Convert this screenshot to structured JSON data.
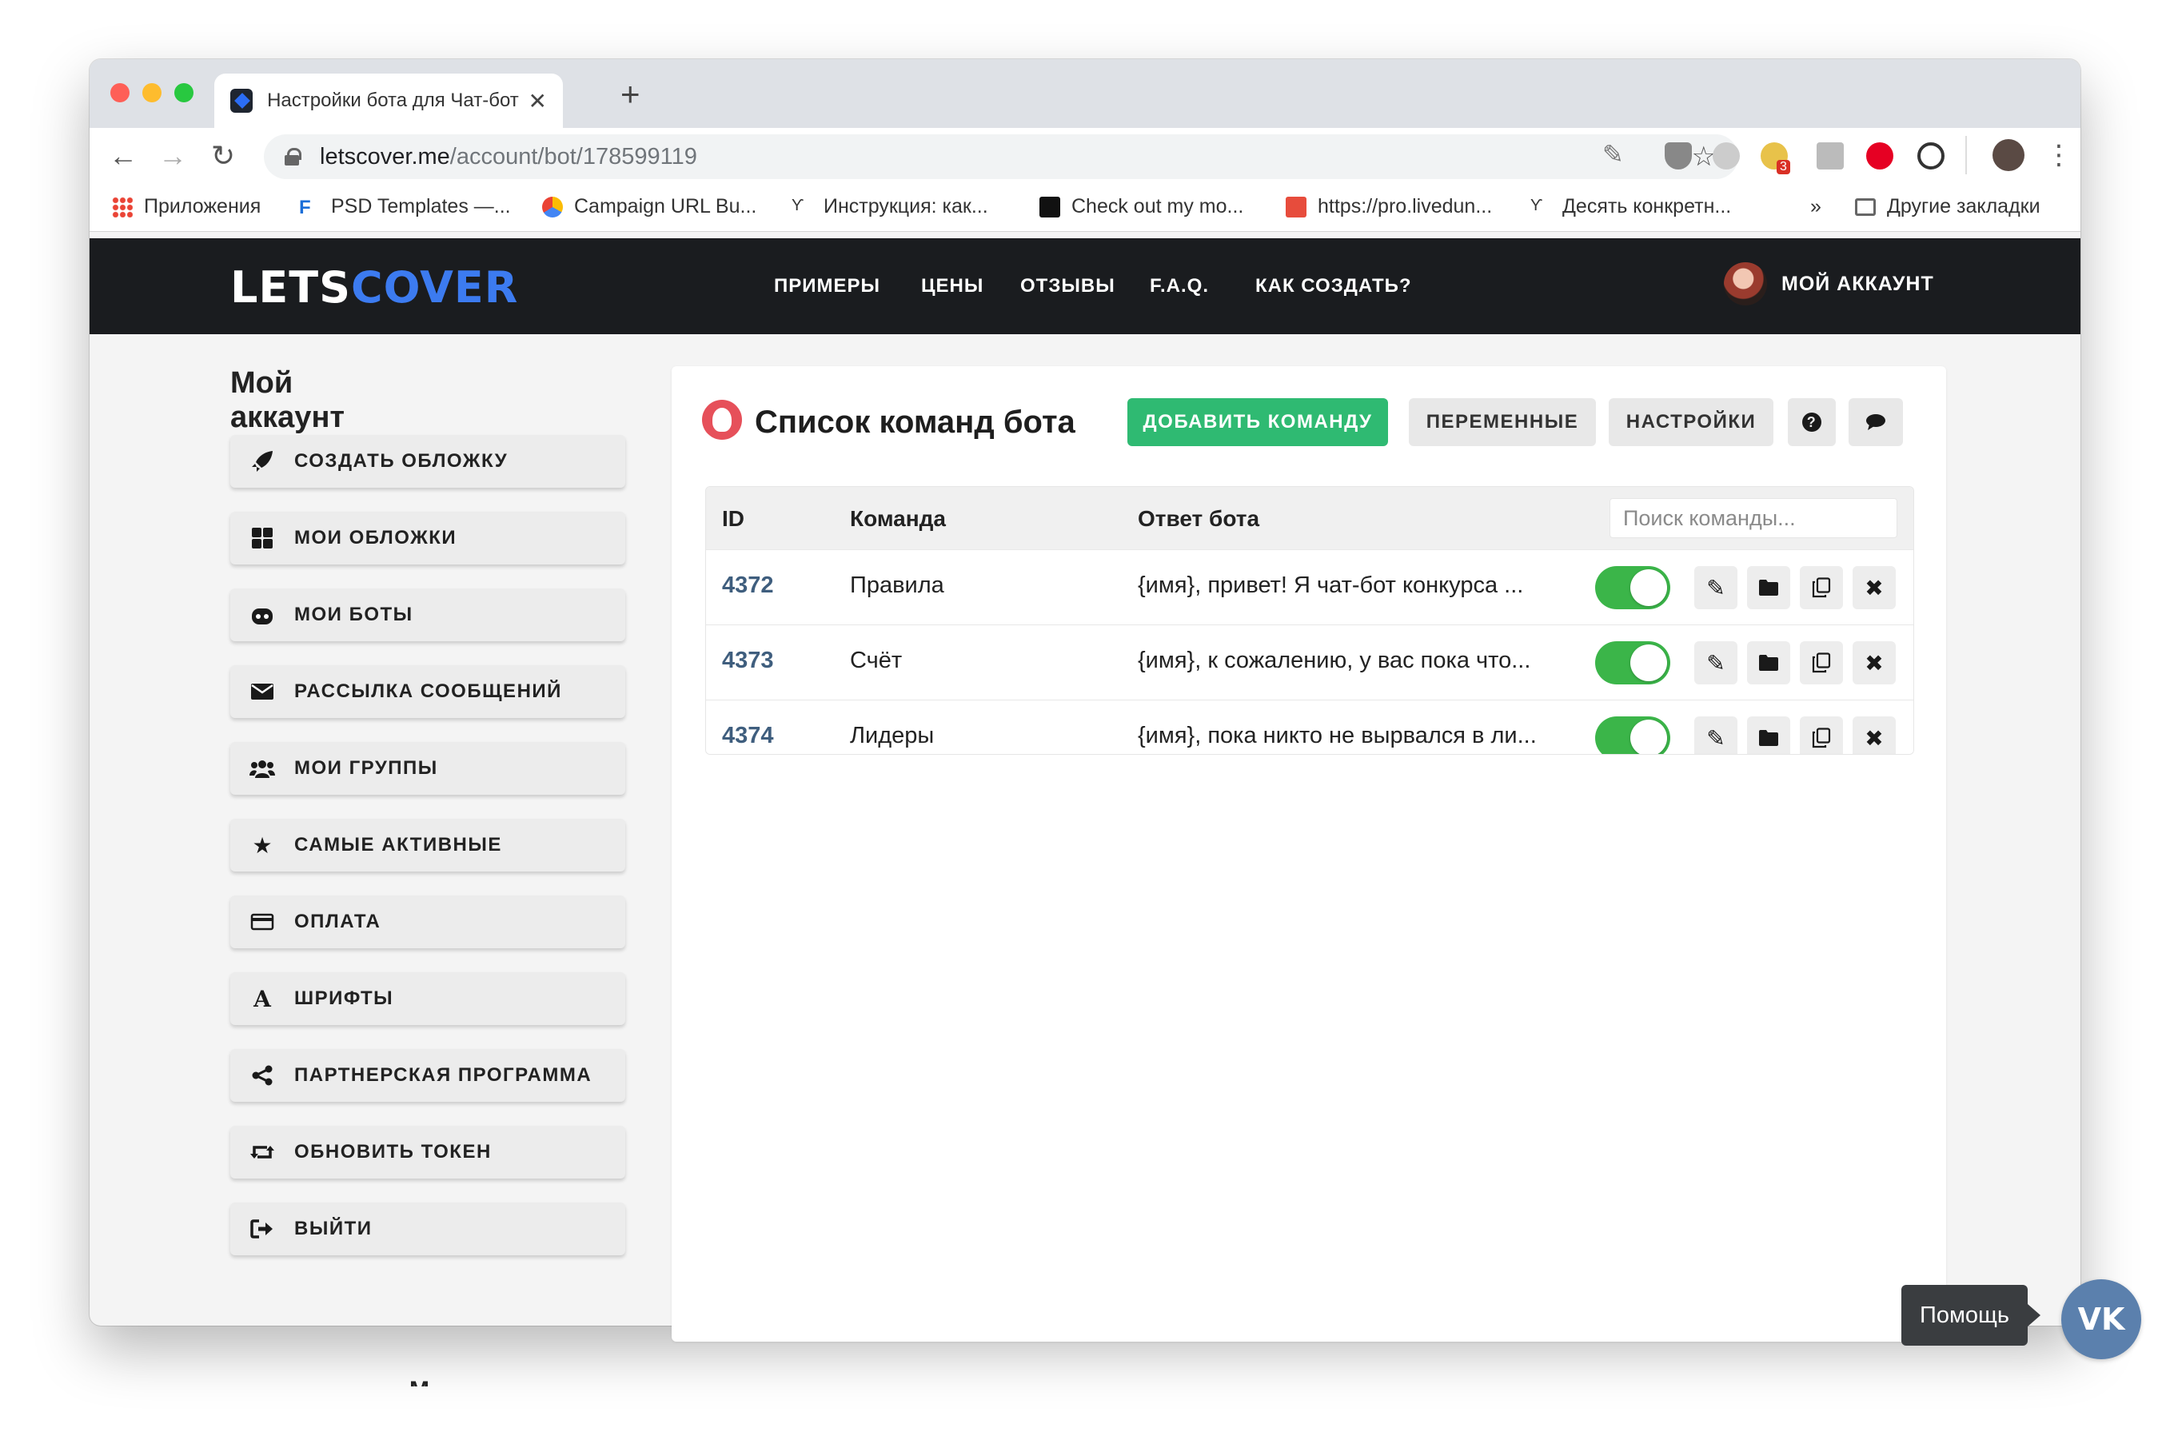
{
  "browser": {
    "tab_title": "Настройки бота для Чат-бот |",
    "tab_close": "✕",
    "new_tab": "+",
    "url_host": "letscover.me",
    "url_path": "/account/bot/178599119",
    "extension_badge": "3",
    "bookmarks": [
      {
        "label": "Приложения",
        "icon": "apps-grid-icon"
      },
      {
        "label": "PSD Templates —...",
        "icon": "psd-icon"
      },
      {
        "label": "Campaign URL Bu...",
        "icon": "campaign-icon"
      },
      {
        "label": "Инструкция: как...",
        "icon": "ycombinator-icon"
      },
      {
        "label": "Check out my mo...",
        "icon": "square-icon"
      },
      {
        "label": "https://pro.livedun...",
        "icon": "livedune-icon"
      },
      {
        "label": "Десять конкретн...",
        "icon": "ycombinator-icon"
      }
    ],
    "bookmarks_more": "»",
    "other_bookmarks": "Другие закладки"
  },
  "site": {
    "logo_lets": "LETS",
    "logo_cover": "COVER",
    "menu": [
      "ПРИМЕРЫ",
      "ЦЕНЫ",
      "ОТЗЫВЫ",
      "F.A.Q.",
      "КАК СОЗДАТЬ?"
    ],
    "account_label": "МОЙ АККАУНТ"
  },
  "sidebar": {
    "title": "Мой аккаунт",
    "items": [
      {
        "label": "СОЗДАТЬ ОБЛОЖКУ",
        "icon": "rocket-icon"
      },
      {
        "label": "МОИ ОБЛОЖКИ",
        "icon": "grid-icon"
      },
      {
        "label": "МОИ БОТЫ",
        "icon": "bot-icon"
      },
      {
        "label": "РАССЫЛКА СООБЩЕНИЙ",
        "icon": "envelope-icon"
      },
      {
        "label": "МОИ ГРУППЫ",
        "icon": "users-icon"
      },
      {
        "label": "САМЫЕ АКТИВНЫЕ",
        "icon": "star-icon"
      },
      {
        "label": "ОПЛАТА",
        "icon": "credit-card-icon"
      },
      {
        "label": "ШРИФТЫ",
        "icon": "font-icon"
      },
      {
        "label": "ПАРТНЕРСКАЯ ПРОГРАММА",
        "icon": "share-icon"
      },
      {
        "label": "ОБНОВИТЬ ТОКЕН",
        "icon": "retweet-icon"
      },
      {
        "label": "ВЫЙТИ",
        "icon": "sign-out-icon"
      }
    ]
  },
  "main": {
    "title": "Список команд бота",
    "add_button": "ДОБАВИТЬ КОМАНДУ",
    "variables_button": "ПЕРЕМЕННЫЕ",
    "settings_button": "НАСТРОЙКИ",
    "help_icon": "?",
    "chat_icon": "💬",
    "columns": [
      "ID",
      "Команда",
      "Ответ бота"
    ],
    "search_placeholder": "Поиск команды...",
    "rows": [
      {
        "id": "4372",
        "command": "Правила",
        "answer": "{имя}, привет! Я чат-бот конкурса ...",
        "enabled": true
      },
      {
        "id": "4373",
        "command": "Счёт",
        "answer": "{имя}, к сожалению, у вас пока что...",
        "enabled": true
      },
      {
        "id": "4374",
        "command": "Лидеры",
        "answer": "{имя}, пока никто не вырвался в ли...",
        "enabled": true
      }
    ],
    "actions": {
      "edit": "✎",
      "folder": "▆",
      "copy": "⧉",
      "delete": "✖"
    }
  },
  "help": {
    "tooltip": "Помощь",
    "vk_label": "VK"
  },
  "colors": {
    "accent_green": "#2fba72",
    "toggle_green": "#3bb549",
    "logo_blue": "#3c7bf0",
    "header_dark": "#1a1c1f",
    "id_link": "#3f5e7e",
    "vk_blue": "#5b80ad"
  }
}
